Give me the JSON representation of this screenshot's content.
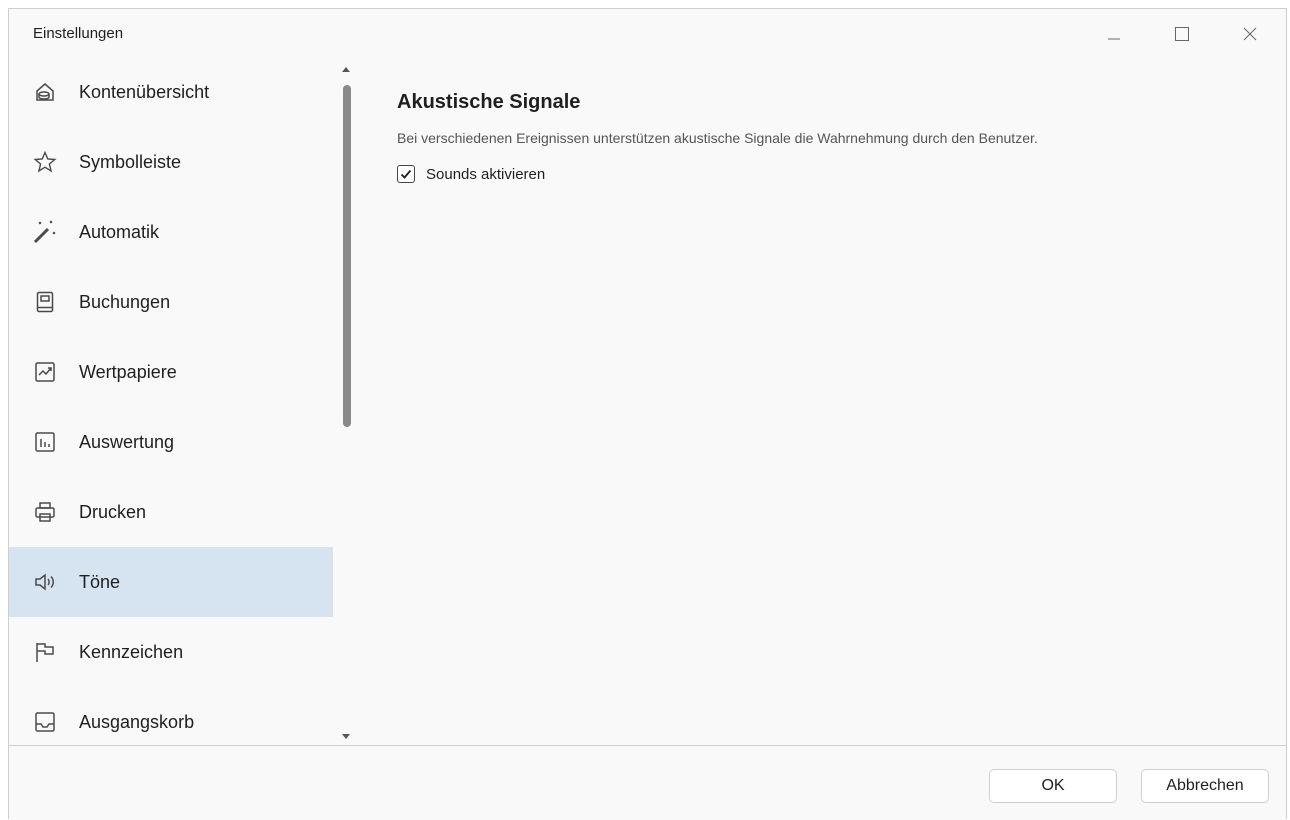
{
  "window": {
    "title": "Einstellungen",
    "controls": {
      "minimize": "minimize-icon",
      "maximize": "maximize-icon",
      "close": "close-icon"
    }
  },
  "sidebar": {
    "items": [
      {
        "label": "Kontenübersicht",
        "icon": "accounts-icon"
      },
      {
        "label": "Symbolleiste",
        "icon": "star-icon"
      },
      {
        "label": "Automatik",
        "icon": "magic-wand-icon"
      },
      {
        "label": "Buchungen",
        "icon": "book-icon"
      },
      {
        "label": "Wertpapiere",
        "icon": "chart-trend-icon"
      },
      {
        "label": "Auswertung",
        "icon": "bar-chart-icon"
      },
      {
        "label": "Drucken",
        "icon": "printer-icon"
      },
      {
        "label": "Töne",
        "icon": "speaker-icon",
        "selected": true
      },
      {
        "label": "Kennzeichen",
        "icon": "flag-icon"
      },
      {
        "label": "Ausgangskorb",
        "icon": "inbox-tray-icon"
      }
    ]
  },
  "content": {
    "heading": "Akustische Signale",
    "description": "Bei verschiedenen Ereignissen unterstützen akustische Signale die Wahrnehmung durch den Benutzer.",
    "checkbox": {
      "label": "Sounds aktivieren",
      "checked": true
    }
  },
  "footer": {
    "ok_label": "OK",
    "cancel_label": "Abbrechen"
  },
  "colors": {
    "selected_bg": "#d6e4f2",
    "window_bg": "#f9f9f9"
  }
}
